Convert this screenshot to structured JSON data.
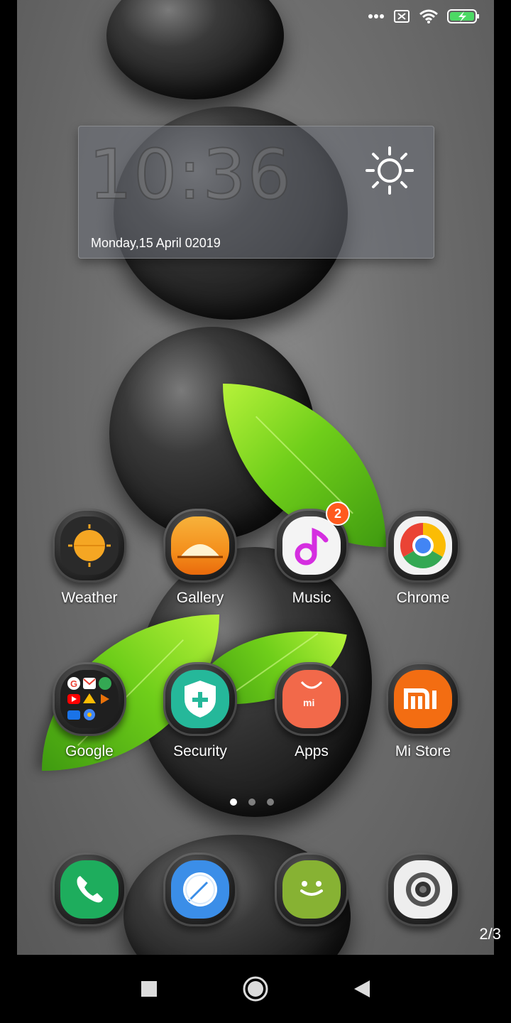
{
  "status_bar": {
    "icons": [
      "more-dots-icon",
      "sim-off-icon",
      "wifi-icon",
      "battery-charging-icon"
    ]
  },
  "clock_widget": {
    "time": "10:36",
    "date": "Monday,15 April 02019",
    "weather_icon": "sun-icon"
  },
  "apps_row1": [
    {
      "label": "Weather",
      "icon": "weather-icon",
      "color": "#f5a623"
    },
    {
      "label": "Gallery",
      "icon": "gallery-icon",
      "color": "#f6a128"
    },
    {
      "label": "Music",
      "icon": "music-icon",
      "color": "#d52ee0",
      "badge": "2"
    },
    {
      "label": "Chrome",
      "icon": "chrome-icon",
      "color": "#4285f4"
    }
  ],
  "apps_row2": [
    {
      "label": "Google",
      "icon": "google-folder-icon",
      "color": "#ffffff"
    },
    {
      "label": "Security",
      "icon": "security-icon",
      "color": "#25b89a"
    },
    {
      "label": "Apps",
      "icon": "mi-apps-icon",
      "color": "#f2694a"
    },
    {
      "label": "Mi Store",
      "icon": "mi-store-icon",
      "color": "#f36d12"
    }
  ],
  "dock": [
    {
      "icon": "phone-icon",
      "color": "#1ead5d"
    },
    {
      "icon": "browser-icon",
      "color": "#3b8ee8"
    },
    {
      "icon": "messaging-icon",
      "color": "#87b233"
    },
    {
      "icon": "camera-icon",
      "color": "#e8e8e8"
    }
  ],
  "page_dots": {
    "count": 3,
    "active": 1
  },
  "page_indicator": "2/3",
  "nav": {
    "icons": [
      "recents-square-icon",
      "home-circle-icon",
      "back-triangle-icon"
    ]
  }
}
